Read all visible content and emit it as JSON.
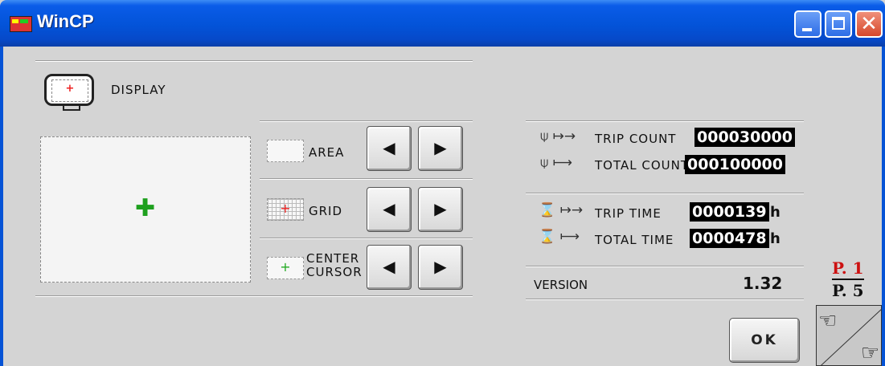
{
  "window": {
    "title": "WinCP",
    "minimize_icon": "minimize-icon",
    "maximize_icon": "maximize-icon",
    "close_icon": "close-icon"
  },
  "display": {
    "label": "DISPLAY"
  },
  "settings": {
    "area": {
      "label": "AREA"
    },
    "grid": {
      "label": "GRID"
    },
    "center_cursor": {
      "label_line1": "CENTER",
      "label_line2": "CURSOR"
    },
    "left_arrow": "◀",
    "right_arrow": "▶"
  },
  "counters": {
    "trip_count": {
      "label": "TRIP COUNT",
      "value": "000030000"
    },
    "total_count": {
      "label": "TOTAL COUNT",
      "value": "000100000"
    },
    "trip_time": {
      "label": "TRIP TIME",
      "value": "0000139",
      "unit": "h"
    },
    "total_time": {
      "label": "TOTAL TIME",
      "value": "0000478",
      "unit": "h"
    }
  },
  "version": {
    "label": "VERSION",
    "value": "1.32"
  },
  "page": {
    "current": "P. 1",
    "total": "P. 5",
    "current_color": "#cc1111"
  },
  "ok_button": {
    "label": "OK"
  },
  "colors": {
    "titlebar": "#0553d6",
    "background": "#d4d4d4",
    "cursor_cross": "#1ea01e"
  }
}
